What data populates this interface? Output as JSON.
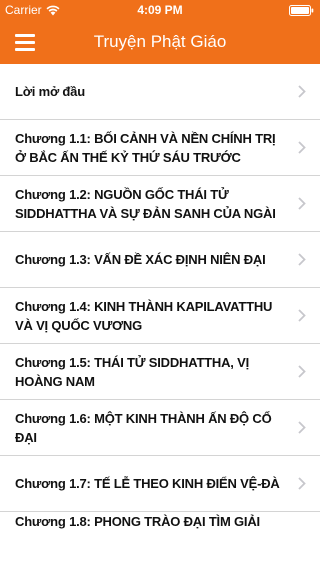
{
  "status_bar": {
    "carrier": "Carrier",
    "time": "4:09 PM",
    "icons": [
      "wifi-icon",
      "battery-icon"
    ]
  },
  "nav": {
    "title": "Truyện Phật Giáo",
    "menu_icon": "hamburger-menu-icon"
  },
  "colors": {
    "accent": "#f0701a",
    "text": "#111111",
    "separator": "#d4d4d4",
    "chevron": "#c7c7cc"
  },
  "list": {
    "items": [
      {
        "label": "Lời mở đầu"
      },
      {
        "label": "Chương 1.1: BỐI CẢNH VÀ NỀN CHÍNH TRỊ Ở BẮC ẤN THẾ KỶ THỨ SÁU TRƯỚC"
      },
      {
        "label": "Chương 1.2: NGUỒN GỐC THÁI TỬ SIDDHATTHA VÀ SỰ ĐẢN SANH CỦA NGÀI"
      },
      {
        "label": "Chương 1.3: VẤN ĐỀ XÁC ĐỊNH NIÊN ĐẠI"
      },
      {
        "label": "Chương 1.4: KINH THÀNH KAPILAVATTHU VÀ VỊ QUỐC VƯƠNG"
      },
      {
        "label": "Chương 1.5: THÁI TỬ SIDDHATTHA, VỊ HOÀNG NAM"
      },
      {
        "label": "Chương 1.6: MỘT KINH THÀNH ẤN ĐỘ CỔ ĐẠI"
      },
      {
        "label": "Chương 1.7: TẾ LỄ THEO KINH ĐIỂN VỆ-ĐÀ"
      },
      {
        "label": "Chương 1.8: PHONG TRÀO ĐẠI TÌM GIẢI"
      }
    ]
  }
}
